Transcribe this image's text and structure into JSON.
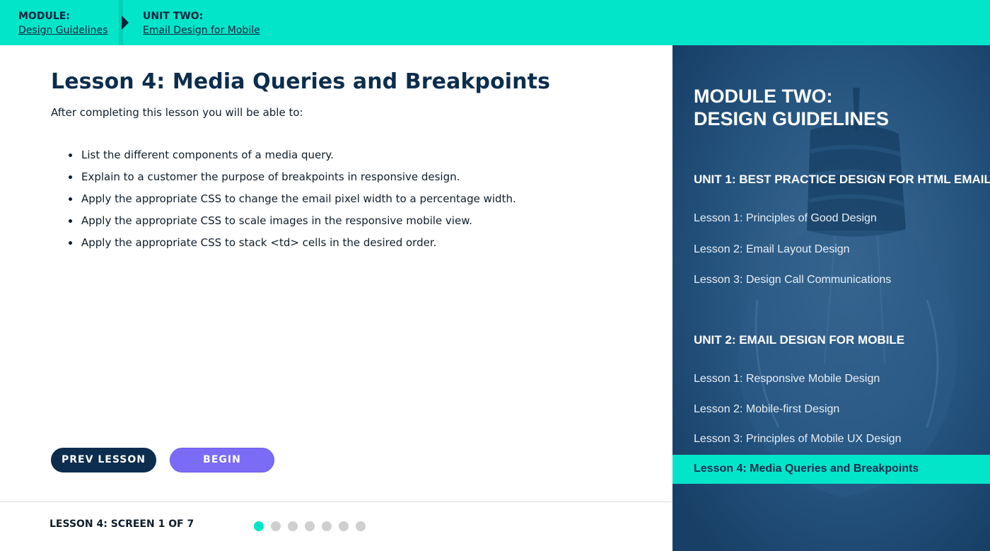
{
  "header": {
    "module_label": "MODULE:",
    "module_link": "Design Guidelines",
    "unit_label": "UNIT TWO:",
    "unit_link": "Email Design for Mobile"
  },
  "lesson": {
    "title": "Lesson 4: Media Queries and Breakpoints",
    "intro": "After completing this lesson you will be able to:",
    "objectives": [
      "List the different components of a media query.",
      "Explain to a customer the purpose of breakpoints in responsive design.",
      "Apply the appropriate CSS to change the email pixel width to a percentage width.",
      "Apply the appropriate CSS to scale images in the responsive mobile view.",
      "Apply the appropriate CSS to stack <td> cells in the desired order."
    ]
  },
  "buttons": {
    "prev": "PREV LESSON",
    "begin": "BEGIN"
  },
  "footer": {
    "screen_counter": "LESSON 4: SCREEN 1 OF 7",
    "total_screens": 7,
    "current_screen": 1
  },
  "sidebar": {
    "title_line1": "MODULE TWO:",
    "title_line2": "DESIGN GUIDELINES",
    "units": [
      {
        "heading": "UNIT 1: BEST PRACTICE DESIGN FOR HTML EMAIL",
        "lessons": [
          "Lesson 1: Principles of Good Design",
          "Lesson 2: Email Layout Design",
          "Lesson 3: Design Call Communications"
        ]
      },
      {
        "heading": "UNIT 2: EMAIL DESIGN FOR MOBILE",
        "lessons": [
          "Lesson 1: Responsive Mobile Design",
          "Lesson 2: Mobile-first Design",
          "Lesson 3: Principles of Mobile UX Design",
          "Lesson 4: Media Queries and Breakpoints"
        ]
      }
    ]
  },
  "colors": {
    "accent_teal": "#03e5c9",
    "navy": "#0c2d4d",
    "begin_purple": "#7b6cf6",
    "sidebar_blue": "#1f4d78"
  }
}
